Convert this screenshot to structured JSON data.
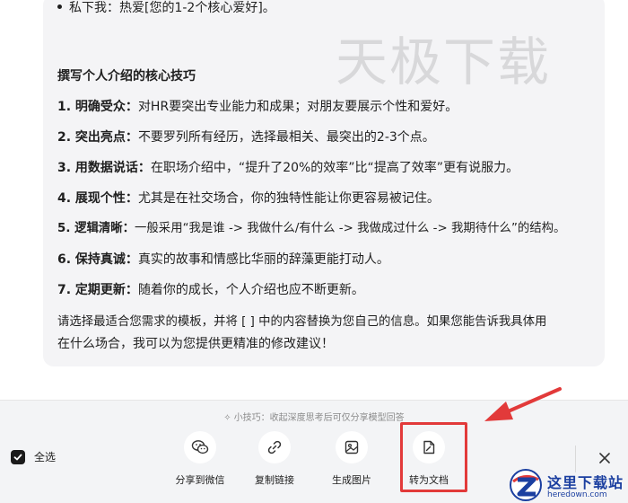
{
  "message": {
    "partial_top_line": "私下我：热爱[您的1-2个核心爱好]。",
    "watermark": "天极下载",
    "heading": "撰写个人介绍的核心技巧",
    "tips": [
      {
        "label": "1. 明确受众：",
        "text": "对HR要突出专业能力和成果；对朋友要展示个性和爱好。"
      },
      {
        "label": "2. 突出亮点：",
        "text": "不要罗列所有经历，选择最相关、最突出的2-3个点。"
      },
      {
        "label": "3. 用数据说话：",
        "text": "在职场介绍中，“提升了20%的效率”比“提高了效率”更有说服力。"
      },
      {
        "label": "4. 展现个性：",
        "text": "尤其是在社交场合，你的独特性能让你更容易被记住。"
      },
      {
        "label": "5. 逻辑清晰：",
        "text": "一般采用“我是谁 -> 我做什么/有什么 -> 我做成过什么 -> 我期待什么”的结构。"
      },
      {
        "label": "6. 保持真诚：",
        "text": "真实的故事和情感比华丽的辞藻更能打动人。"
      },
      {
        "label": "7. 定期更新：",
        "text": "随着你的成长，个人介绍也应不断更新。"
      }
    ],
    "closing_line1": "请选择最适合您需求的模板，并将 [   ] 中的内容替换为您自己的信息。如果您能告诉我具体用",
    "closing_line2": "在什么场合，我可以为您提供更精准的修改建议！"
  },
  "toolbar": {
    "tip": "小技巧：收起深度思考后可仅分享模型回答",
    "select_all": "全选",
    "actions": [
      {
        "label": "分享到微信",
        "icon": "wechat-icon"
      },
      {
        "label": "复制链接",
        "icon": "link-icon"
      },
      {
        "label": "生成图片",
        "icon": "image-icon"
      },
      {
        "label": "转为文档",
        "icon": "document-icon"
      }
    ]
  },
  "logo": {
    "cn": "这里下载站",
    "en": "heredown.com"
  },
  "colors": {
    "accent_red": "#e23a3a",
    "logo_blue": "#1b3fa0"
  }
}
